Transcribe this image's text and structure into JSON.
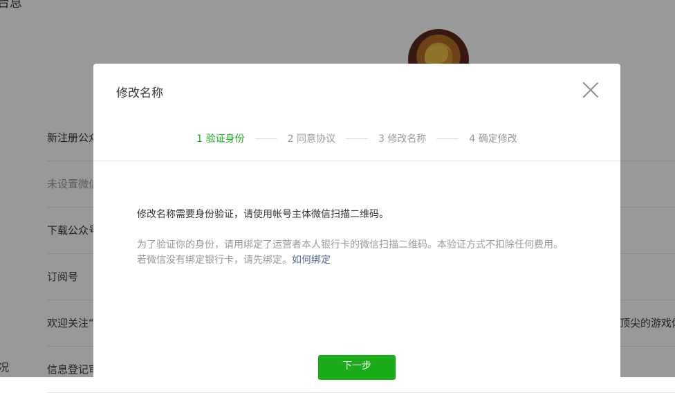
{
  "background": {
    "heading": "台息",
    "rows": [
      {
        "label": "新注册公众"
      },
      {
        "label": "未设置微信"
      },
      {
        "label": "下载公众号"
      },
      {
        "label": "订阅号"
      },
      {
        "label": "欢迎关注“"
      },
      {
        "label": "信息登记审"
      }
    ],
    "side_label": "况",
    "right_text": "顶尖的游戏体"
  },
  "dialog": {
    "title": "修改名称",
    "close_icon": "close-icon",
    "steps": [
      {
        "label": "1 验证身份",
        "active": true
      },
      {
        "label": "2 同意协议",
        "active": false
      },
      {
        "label": "3 修改名称",
        "active": false
      },
      {
        "label": "4 确定修改",
        "active": false
      }
    ],
    "main_text": "修改名称需要身份验证，请使用帐号主体微信扫描二维码。",
    "desc_line1": "为了验证你的身份，请用绑定了运营者本人银行卡的微信扫描二维码。本验证方式不扣除任何费用。",
    "desc_line2_prefix": "若微信没有绑定银行卡，请先绑定。",
    "desc_link": "如何绑定",
    "next_button": "下一步"
  },
  "colors": {
    "accent_green": "#1aad19",
    "link_blue": "#576b95",
    "muted_text": "#9a9a9a"
  }
}
